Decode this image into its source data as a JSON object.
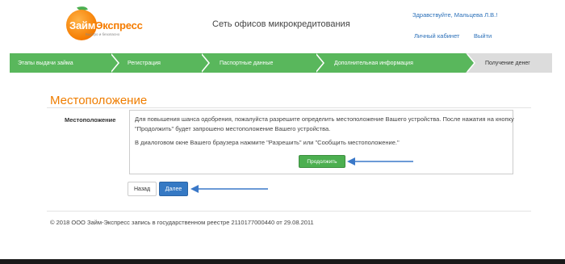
{
  "logo": {
    "word_part1": "Займ",
    "word_part2": "Экспресс",
    "tagline": "Быстро и безопасно"
  },
  "header": {
    "site_title": "Сеть офисов микрокредитования",
    "greeting": "Здравствуйте, Мальцева Л.В.!",
    "cabinet_link": "Личный кабинет",
    "logout_link": "Выйти"
  },
  "steps": [
    {
      "label": "Этапы выдачи займа",
      "state": "done"
    },
    {
      "label": "Регистрация",
      "state": "done"
    },
    {
      "label": "Паспортные данные",
      "state": "done"
    },
    {
      "label": "Дополнительная информация",
      "state": "done"
    },
    {
      "label": "Получение денег",
      "state": "current"
    }
  ],
  "section": {
    "title": "Местоположение",
    "field_label": "Местоположение",
    "paragraph1": "Для повышения шанса одобрения, пожалуйста разрешите определить местоположение Вашего устройства. После нажатия на кнопку \"Продолжить\" будет запрошено местоположение Вашего устройства.",
    "paragraph2": "В диалоговом окне Вашего браузера нажмите \"Разрешить\" или \"Сообщить местоположение.\"",
    "continue_button": "Продолжить"
  },
  "nav": {
    "back_button": "Назад",
    "next_button": "Далее"
  },
  "footer": {
    "text": "© 2018 ООО Займ-Экспресс запись в государственном реестре 2110177000440 от 29.08.2011"
  },
  "colors": {
    "accent_orange": "#ef7d00",
    "step_green": "#59b75c",
    "button_blue": "#3579c4",
    "annotation_arrow": "#3a78c8"
  }
}
